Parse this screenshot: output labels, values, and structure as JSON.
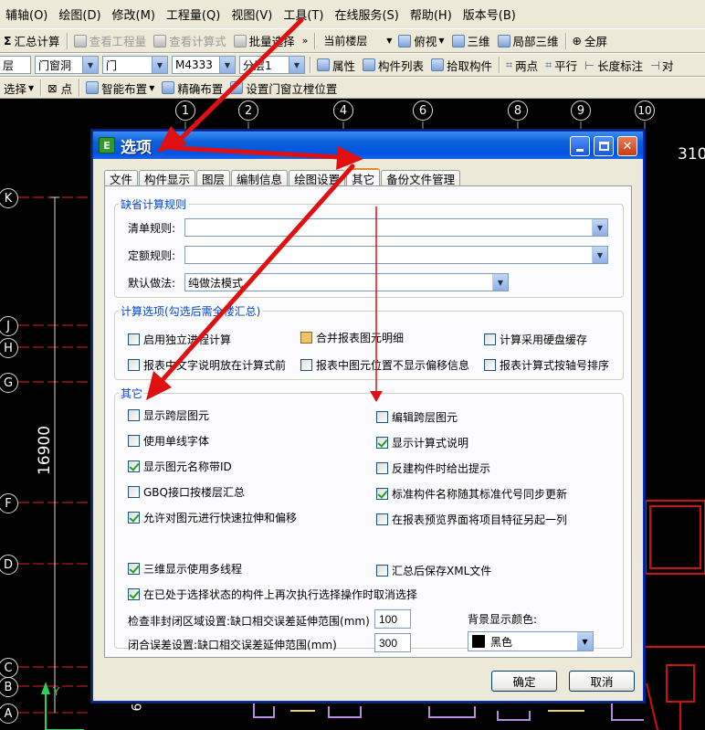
{
  "menu": [
    "辅轴(O)",
    "绘图(D)",
    "修改(M)",
    "工程量(Q)",
    "视图(V)",
    "工具(T)",
    "在线服务(S)",
    "帮助(H)",
    "版本号(B)"
  ],
  "toolbar1": {
    "sum_calc": "汇总计算",
    "view_quantity": "查看工程量",
    "view_formula": "查看计算式",
    "batch_select": "批量选择",
    "floor_combo": "当前楼层",
    "view_mode": "俯视",
    "three_d": "三维",
    "local_3d": "局部三维",
    "fullscreen": "全屏"
  },
  "toolbar2": {
    "floor_value": "层",
    "type_value": "门窗洞",
    "sub_type_value": "门",
    "component_value": "M4333",
    "layer_value": "分层1",
    "property": "属性",
    "component_list": "构件列表",
    "pick_component": "拾取构件",
    "two_points": "两点",
    "parallel": "平行",
    "length_dim": "长度标注",
    "align_more": "对"
  },
  "toolbar3": {
    "select_mode": "选择",
    "point": "点",
    "smart_layout": "智能布置",
    "precise_layout": "精确布置",
    "set_door_window": "设置门窗立樘位置"
  },
  "canvas": {
    "column_axes": [
      "1",
      "2",
      "4",
      "6",
      "8",
      "9",
      "10"
    ],
    "row_axes": [
      "K",
      "J",
      "H",
      "G",
      "F",
      "D",
      "C",
      "B",
      "A"
    ],
    "dimension_label": "16900",
    "top_right_text": "310",
    "bottom_label": "6",
    "y_axis_label": "Y"
  },
  "dialog": {
    "title": "选项",
    "tabs": [
      "文件",
      "构件显示",
      "图层",
      "编制信息",
      "绘图设置",
      "其它",
      "备份文件管理"
    ],
    "active_tab": "其它",
    "default_rules": {
      "title": "缺省计算规则",
      "bill_rule_label": "清单规则:",
      "bill_rule_value": "",
      "quota_rule_label": "定额规则:",
      "quota_rule_value": "",
      "default_method_label": "默认做法:",
      "default_method_value": "纯做法模式"
    },
    "calc_options": {
      "title": "计算选项(勾选后需全楼汇总)",
      "items": [
        {
          "label": "启用独立进程计算",
          "state": "unchecked"
        },
        {
          "label": "合并报表图元明细",
          "state": "mixed"
        },
        {
          "label": "计算采用硬盘缓存",
          "state": "unchecked"
        },
        {
          "label": "报表中文字说明放在计算式前",
          "state": "unchecked"
        },
        {
          "label": "报表中图元位置不显示偏移信息",
          "state": "unchecked"
        },
        {
          "label": "报表计算式按轴号排序",
          "state": "unchecked"
        }
      ]
    },
    "other": {
      "title": "其它",
      "left": [
        {
          "label": "显示跨层图元",
          "checked": false
        },
        {
          "label": "使用单线字体",
          "checked": false
        },
        {
          "label": "显示图元名称带ID",
          "checked": true
        },
        {
          "label": "GBQ接口按楼层汇总",
          "checked": false
        },
        {
          "label": "允许对图元进行快速拉伸和偏移",
          "checked": true
        },
        {
          "label": "三维显示使用多线程",
          "checked": true
        },
        {
          "label": "在已处于选择状态的构件上再次执行选择操作时取消选择",
          "checked": true
        }
      ],
      "right": [
        {
          "label": "编辑跨层图元",
          "checked": false
        },
        {
          "label": "显示计算式说明",
          "checked": true
        },
        {
          "label": "反建构件时给出提示",
          "checked": false
        },
        {
          "label": "标准构件名称随其标准代号同步更新",
          "checked": true
        },
        {
          "label": "在报表预览界面将项目特征另起一列",
          "checked": false
        },
        {
          "label": "汇总后保存XML文件",
          "checked": false
        }
      ],
      "check_unclosed_label": "检查非封闭区域设置:缺口相交误差延伸范围(mm)",
      "check_unclosed_value": "100",
      "closure_error_label": "闭合误差设置:缺口相交误差延伸范围(mm)",
      "closure_error_value": "300",
      "bg_color_label": "背景显示颜色:",
      "bg_color_value": "黑色",
      "bg_color_hex": "#000000"
    },
    "ok_button": "确定",
    "cancel_button": "取消"
  },
  "colors": {
    "annotation_arrow": "#e01010",
    "titlebar": "#0054e3",
    "cad_background": "#000000",
    "cad_red": "#d01010"
  }
}
